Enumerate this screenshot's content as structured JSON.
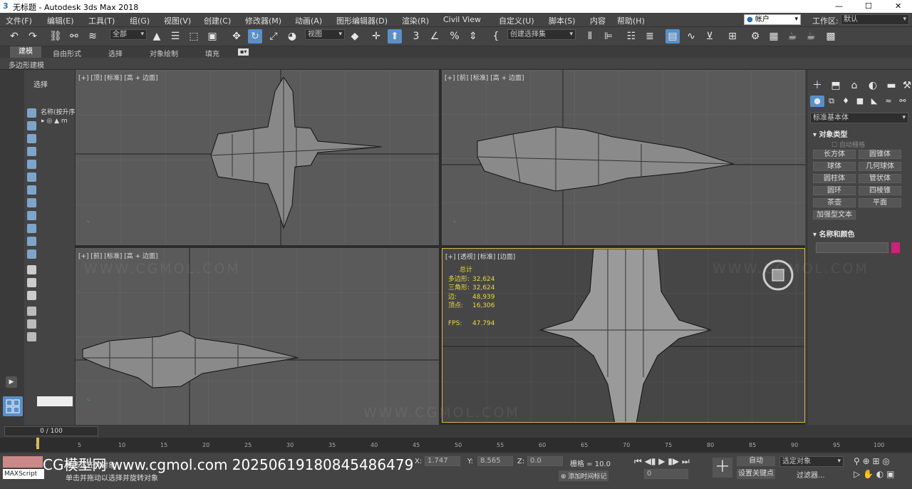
{
  "window": {
    "title": "无标题 - Autodesk 3ds Max 2018",
    "min": "—",
    "max": "☐",
    "close": "✕"
  },
  "menu": [
    "文件(F)",
    "编辑(E)",
    "工具(T)",
    "组(G)",
    "视图(V)",
    "创建(C)",
    "修改器(M)",
    "动画(A)",
    "图形编辑器(D)",
    "渲染(R)",
    "Civil View",
    "自定义(U)",
    "脚本(S)",
    "内容",
    "帮助(H)"
  ],
  "user": "帐户",
  "workspace": {
    "label": "工作区:",
    "value": "默认"
  },
  "toolbar": {
    "select_filter": "全部",
    "ref_coord": "视图",
    "named_selection": "创建选择集"
  },
  "ribbon": {
    "tabs": [
      "建模",
      "自由形式",
      "选择",
      "对象绘制",
      "填充"
    ],
    "active": "建模",
    "subtitle": "多边形建模"
  },
  "explorer": {
    "tab": "选择",
    "column": "名称(按升序排序)",
    "tree_row": "▸ ◎ ▲ m"
  },
  "viewports": [
    {
      "label": "[+] [顶] [标准] [高 + 边面]"
    },
    {
      "label": "[+] [前] [标准] [高 + 边面]"
    },
    {
      "label": "[+] [前] [标准] [高 + 边面]"
    },
    {
      "label": "[+] [透视] [标准] [边面]"
    }
  ],
  "stats": {
    "title": "总计",
    "rows": [
      {
        "k": "多边形:",
        "v": "32,624"
      },
      {
        "k": "三角形:",
        "v": "32,624"
      },
      {
        "k": "边:",
        "v": "48,939"
      },
      {
        "k": "顶点:",
        "v": "16,306"
      }
    ],
    "fps_label": "FPS:",
    "fps": "47.794"
  },
  "command_panel": {
    "dropdown": "标准基本体",
    "section1": "对象类型",
    "autogrid": "自动栅格",
    "buttons": [
      "长方体",
      "圆锥体",
      "球体",
      "几何球体",
      "圆柱体",
      "管状体",
      "圆环",
      "四棱锥",
      "茶壶",
      "平面",
      "加强型文本"
    ],
    "section2": "名称和颜色",
    "color": "#c4267a"
  },
  "timeline": {
    "frame": "0 / 100",
    "ticks": [
      "0",
      "5",
      "10",
      "15",
      "20",
      "25",
      "30",
      "35",
      "40",
      "45",
      "50",
      "55",
      "60",
      "65",
      "70",
      "75",
      "80",
      "85",
      "90",
      "95",
      "100"
    ]
  },
  "status": {
    "watermark": "CG模型网 www.cgmol.com 20250619180845486479",
    "maxscript": "MAXScript",
    "selected": "未选定任何对象",
    "prompt": "单击并拖动以选择并旋转对象",
    "x_label": "X:",
    "x_val": "1.747",
    "y_label": "Y:",
    "y_val": "8.565",
    "z_label": "Z:",
    "z_val": "0.0",
    "grid": "栅格 = 10.0",
    "add_time_tag": "添加时间标记",
    "auto": "自动",
    "selected_obj": "选定对象",
    "set_key": "设置关键点",
    "filter": "过滤器...",
    "frame_val": "0"
  },
  "watermarks": [
    "WWW.CGMOL.COM"
  ]
}
